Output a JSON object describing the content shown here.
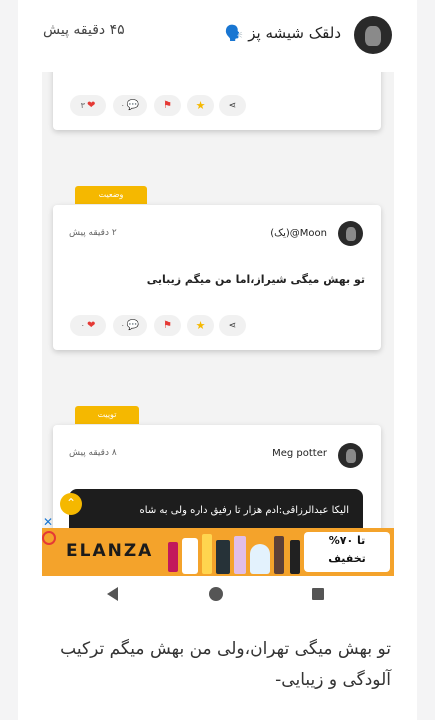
{
  "header": {
    "username": "دلقک شیشه پز 🗣️",
    "time": "۴۵ دقیقه پیش"
  },
  "screenshot": {
    "first_post": {
      "likes": "۳",
      "comments": "۰"
    },
    "second_post": {
      "tag": "وضعیت",
      "author": "Moon@(یک)",
      "time": "۲ دقیقه پیش",
      "text": "تو بهش میگی شیراز،اما من میگم زیبایی",
      "likes": "۰",
      "comments": "۰"
    },
    "third_post": {
      "tag": "توییت",
      "author": "Meg potter",
      "time": "۸ دقیقه پیش",
      "quote": "الیکا عبدالرزاقی:ادم هزار تا رفیق داره ولی به شاه"
    },
    "ad": {
      "brand": "ELANZA",
      "discount_line1": "تا ۷۰%",
      "discount_line2": "تخفیف"
    }
  },
  "caption": "تو بهش میگی تهران،ولی من بهش میگم ترکیب آلودگی و زیبایی-",
  "icons": {
    "heart": "heart-icon",
    "comment": "comment-icon",
    "flag": "flag-icon",
    "star": "star-icon",
    "share": "share-icon"
  },
  "colors": {
    "accent": "#f5b800",
    "heart": "#e53935",
    "ad_background": "#f4a32b"
  }
}
